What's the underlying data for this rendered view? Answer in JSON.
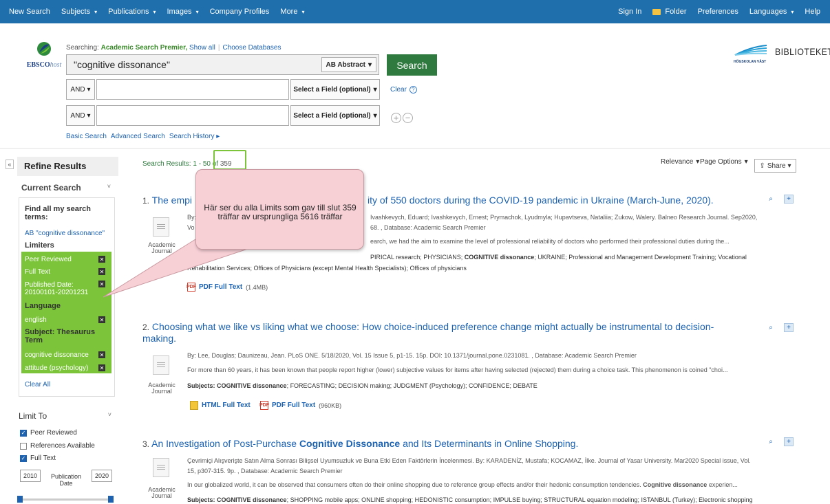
{
  "topnav": {
    "left": [
      "New Search",
      "Subjects",
      "Publications",
      "Images",
      "Company Profiles",
      "More"
    ],
    "right": [
      "Sign In",
      "Folder",
      "Preferences",
      "Languages",
      "Help"
    ]
  },
  "logo": {
    "brand": "EBSCO",
    "host": "host"
  },
  "search": {
    "searching_label": "Searching:",
    "database": "Academic Search Premier,",
    "show_all": "Show all",
    "choose_db": "Choose Databases",
    "query": "\"cognitive dissonance\"",
    "field1": "AB Abstract",
    "bool1": "AND",
    "bool2": "AND",
    "field_placeholder": "Select a Field (optional)",
    "button": "Search",
    "clear": "Clear",
    "links": [
      "Basic Search",
      "Advanced Search",
      "Search History ▸"
    ]
  },
  "library": {
    "school": "HÖGSKOLAN VÄST",
    "name": "BIBLIOTEKET"
  },
  "sidebar": {
    "refine": "Refine Results",
    "current_search": "Current Search",
    "find_all": "Find all my search terms:",
    "ab_term": "AB \"cognitive dissonance\"",
    "limiters": "Limiters",
    "limiter_items": [
      "Peer Reviewed",
      "Full Text"
    ],
    "pubdate_line1": "Published Date:",
    "pubdate_line2": "20100101-20201231",
    "language": "Language",
    "language_item": "english",
    "subject_head": "Subject: Thesaurus Term",
    "subject_items": [
      "cognitive dissonance",
      "attitude (psychology)"
    ],
    "clear_all": "Clear All",
    "limit_to": "Limit To",
    "checkboxes": [
      "Peer Reviewed",
      "References Available",
      "Full Text"
    ],
    "year_from": "2010",
    "year_to": "2020",
    "pub_line1": "Publication",
    "pub_line2": "Date"
  },
  "results": {
    "count_prefix": "Search Results:",
    "count_range": "1 - 50 of",
    "count_total": "359",
    "relevance": "Relevance",
    "page_options": "Page Options",
    "share": "Share",
    "doc_type_line1": "Academic",
    "doc_type_line2": "Journal",
    "items": [
      {
        "num": "1.",
        "title_a": "The empi",
        "title_b": "ity of 550 doctors during the COVID-19 pandemic in Ukraine (March-June, 2020).",
        "meta1_a": "By:",
        "meta1_b": "Ivashkevych, Eduard; Ivashkevych, Ernest; Prymachok, Lyudmyla; Hupavtseva, Nataliia; Zukow, Walery. Balneo Research Journal. Sep2020,",
        "meta2_a": "Vo",
        "meta2_b": "68. , Database: Academic Search Premier",
        "abstract": "earch, we had the aim to examine the level of professional reliability of doctors who performed their professional duties during the...",
        "subj_a": "Sub",
        "subj_b": "PIRICAL research; PHYSICIANS;",
        "subj_bold": "COGNITIVE dissonance",
        "subj_c": "; UKRAINE; Professional and Management Development Training; Vocational",
        "subj2": "Rehabilitation Services; Offices of Physicians (except Mental Health Specialists); Offices of physicians",
        "pdf": "PDF Full Text",
        "pdf_size": "(1.4MB)"
      },
      {
        "num": "2.",
        "title_line1": "Choosing what we like vs liking what we choose: How choice-induced preference change might actually be instrumental to decision-",
        "title_line2": "making.",
        "meta": "By: Lee, Douglas; Daunizeau, Jean. PLoS ONE. 5/18/2020, Vol. 15 Issue 5, p1-15. 15p. DOI: 10.1371/journal.pone.0231081. , Database: Academic Search Premier",
        "abstract": "For more than 60 years, it has been known that people report higher (lower) subjective values for items after having selected (rejected) them during a choice task. This phenomenon is coined \"choi...",
        "subj_label": "Subjects:",
        "subj_bold": "COGNITIVE dissonance",
        "subj_rest": "; FORECASTING; DECISION making; JUDGMENT (Psychology); CONFIDENCE; DEBATE",
        "html": "HTML Full Text",
        "pdf": "PDF Full Text",
        "pdf_size": "(960KB)"
      },
      {
        "num": "3.",
        "title_a": "An Investigation of Post-Purchase",
        "title_bold": "Cognitive Dissonance",
        "title_c": "and Its Determinants in Online Shopping.",
        "meta1": "Çevrimiçi Alışverişte Satın Alma Sonrası Bilişsel Uyumsuzluk ve Buna Etki Eden Faktörlerin İncelenmesi. By: KARADENİZ, Mustafa; KOCAMAZ, İlke. Journal of Yasar University. Mar2020 Special issue, Vol.",
        "meta2": "15, p307-315. 9p. , Database: Academic Search Premier",
        "abstract_a": "In our globalized world, it can be observed that consumers often do their online shopping due to reference group effects and/or their hedonic consumption tendencies.",
        "abstract_bold": "Cognitive dissonance",
        "abstract_c": "experien...",
        "subj_label": "Subjects:",
        "subj_bold": "COGNITIVE dissonance",
        "subj_rest": "; SHOPPING mobile apps; ONLINE shopping; HEDONISTIC consumption; IMPULSE buying; STRUCTURAL equation modeling; ISTANBUL (Turkey); Electronic shopping"
      }
    ]
  },
  "callout": {
    "text": "Här ser du alla Limits som gav till slut 359 träffar av ursprungliga 5616 träffar"
  },
  "colors": {
    "nav": "#1f6fad",
    "green": "#7cc53a",
    "search_btn": "#2f7a3e",
    "callout": "#f7d0d6",
    "link": "#1c62b0"
  }
}
